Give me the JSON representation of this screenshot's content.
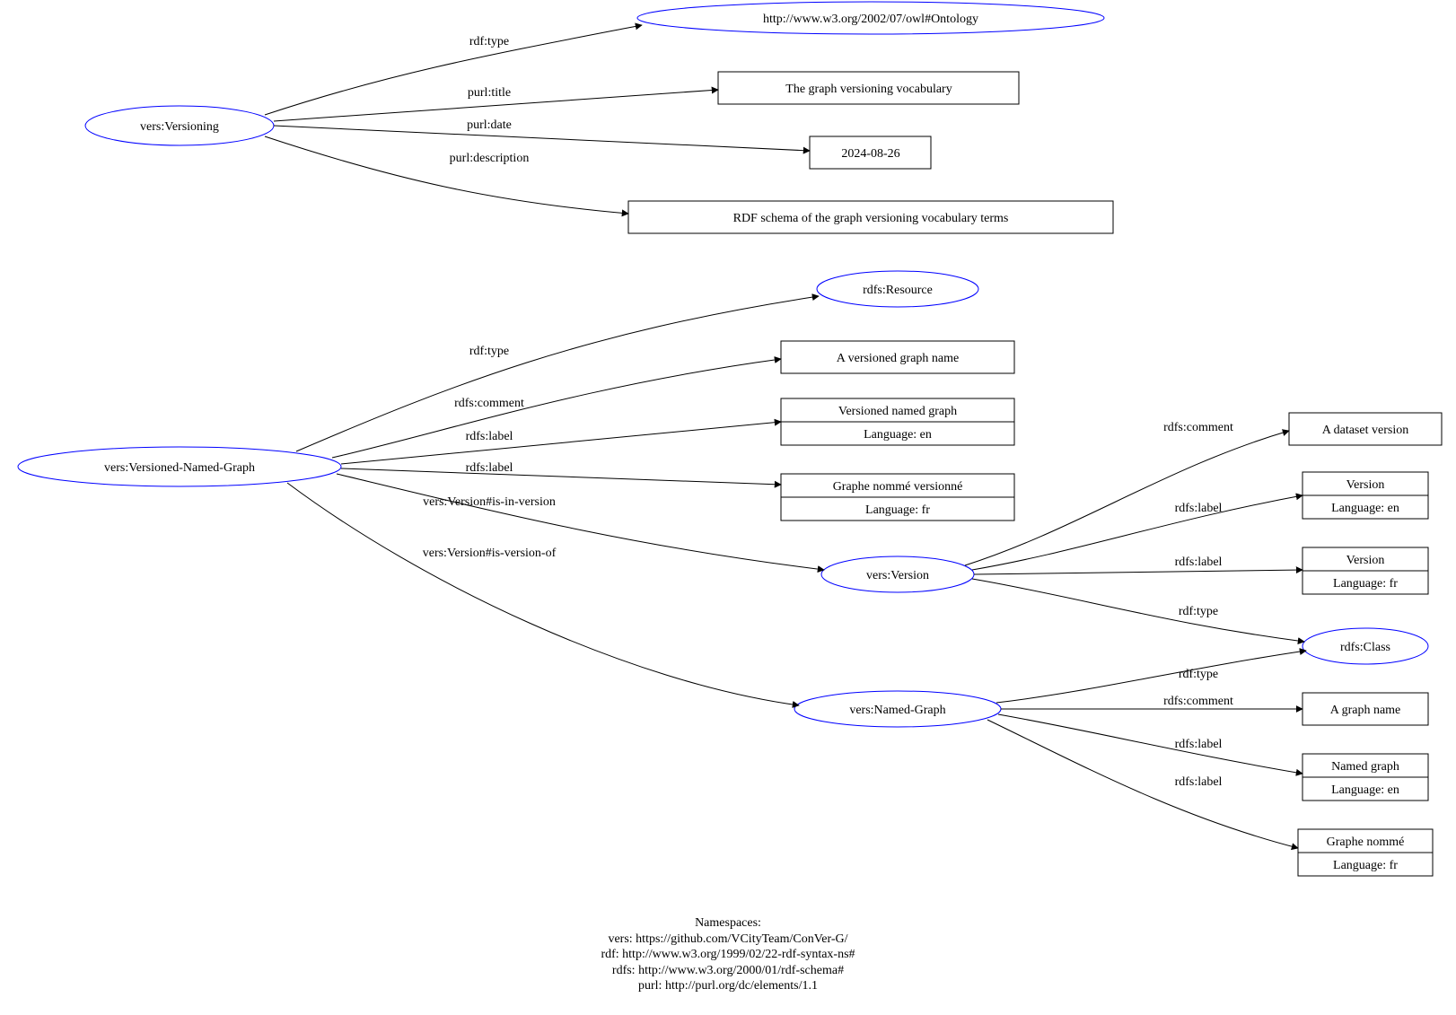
{
  "diagram": {
    "nodes": {
      "versioning": "vers:Versioning",
      "owlOntology": "http://www.w3.org/2002/07/owl#Ontology",
      "title": "The graph versioning vocabulary",
      "date": "2024-08-26",
      "description": "RDF schema of the graph versioning vocabulary terms",
      "vng": "vers:Versioned-Named-Graph",
      "rdfsResource": "rdfs:Resource",
      "vngComment": "A versioned graph name",
      "vngLabelEn1": "Versioned named graph",
      "vngLabelEnLang": "Language: en",
      "vngLabelFr1": "Graphe nommé versionné",
      "vngLabelFrLang": "Language: fr",
      "versVersion": "vers:Version",
      "versionComment": "A dataset version",
      "versionLabelEn": "Version",
      "versionLabelEnLang": "Language: en",
      "versionLabelFr": "Version",
      "versionLabelFrLang": "Language: fr",
      "rdfsClass": "rdfs:Class",
      "namedGraph": "vers:Named-Graph",
      "ngComment": "A graph name",
      "ngLabelEn": "Named graph",
      "ngLabelEnLang": "Language: en",
      "ngLabelFr": "Graphe nommé",
      "ngLabelFrLang": "Language: fr"
    },
    "edges": {
      "rdfType": "rdf:type",
      "purlTitle": "purl:title",
      "purlDate": "purl:date",
      "purlDescription": "purl:description",
      "rdfsComment": "rdfs:comment",
      "rdfsLabel": "rdfs:label",
      "isInVersion": "vers:Version#is-in-version",
      "isVersionOf": "vers:Version#is-version-of"
    },
    "namespaces": {
      "heading": "Namespaces:",
      "vers": "vers: https://github.com/VCityTeam/ConVer-G/",
      "rdf": "rdf: http://www.w3.org/1999/02/22-rdf-syntax-ns#",
      "rdfs": "rdfs: http://www.w3.org/2000/01/rdf-schema#",
      "purl": "purl: http://purl.org/dc/elements/1.1"
    }
  }
}
